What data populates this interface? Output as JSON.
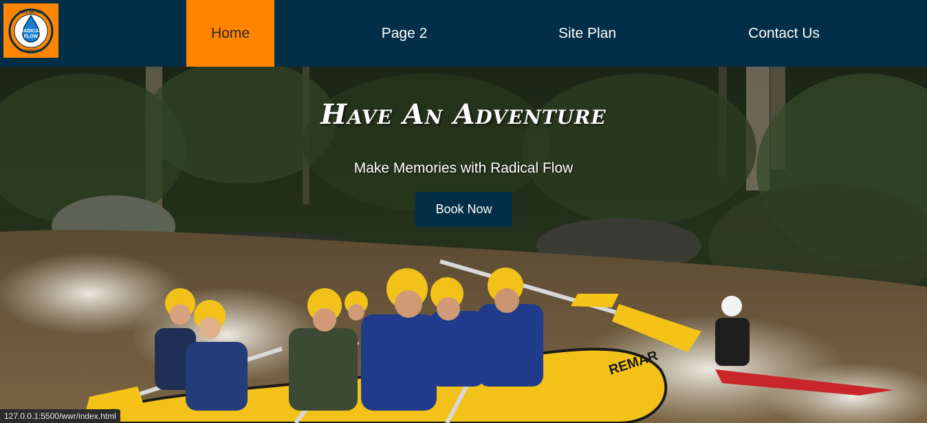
{
  "logo": {
    "top_text": "SAFE ON TRIP",
    "name_line1": "RADICAL",
    "name_line2": "FLOW",
    "bottom_text": "& ADVENTURE",
    "background": "#ff8400"
  },
  "nav": {
    "items": [
      {
        "label": "Home",
        "active": true
      },
      {
        "label": "Page 2",
        "active": false
      },
      {
        "label": "Site Plan",
        "active": false
      },
      {
        "label": "Contact Us",
        "active": false
      }
    ],
    "background": "#022e48",
    "active_color": "#ff8400"
  },
  "hero": {
    "title": "Have An Adventure",
    "subtitle": "Make Memories with Radical Flow",
    "cta_label": "Book Now",
    "raft_brand": "REMAR",
    "paddle_brand": "normal",
    "image_description_icon": "rafting-photo"
  },
  "status_bar": {
    "url": "127.0.0.1:5500/wwr/index.html"
  }
}
